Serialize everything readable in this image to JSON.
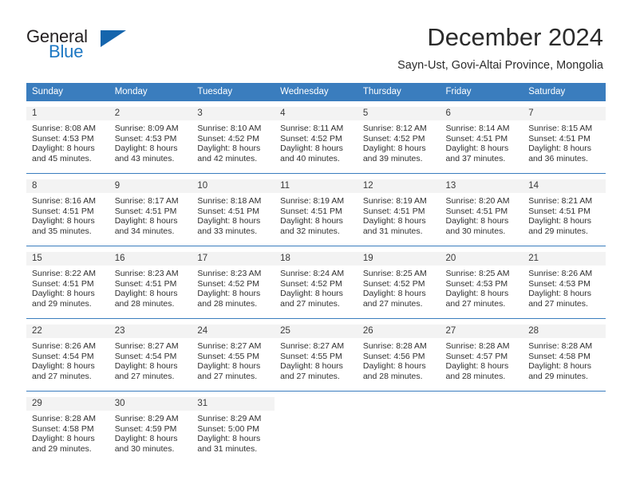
{
  "brand": {
    "name_part1": "General",
    "name_part2": "Blue",
    "triangle_icon": "triangle-logo-icon",
    "color_dark": "#231f20",
    "color_blue": "#1c77c3"
  },
  "header": {
    "month_title": "December 2024",
    "location": "Sayn-Ust, Govi-Altai Province, Mongolia"
  },
  "theme": {
    "header_blue": "#3a7dbe",
    "daynum_gray": "#f3f3f3",
    "text": "#303030"
  },
  "calendar": {
    "weekday_headers": [
      "Sunday",
      "Monday",
      "Tuesday",
      "Wednesday",
      "Thursday",
      "Friday",
      "Saturday"
    ],
    "weeks": [
      [
        {
          "day": "1",
          "sunrise": "Sunrise: 8:08 AM",
          "sunset": "Sunset: 4:53 PM",
          "daylight_line1": "Daylight: 8 hours",
          "daylight_line2": "and 45 minutes."
        },
        {
          "day": "2",
          "sunrise": "Sunrise: 8:09 AM",
          "sunset": "Sunset: 4:53 PM",
          "daylight_line1": "Daylight: 8 hours",
          "daylight_line2": "and 43 minutes."
        },
        {
          "day": "3",
          "sunrise": "Sunrise: 8:10 AM",
          "sunset": "Sunset: 4:52 PM",
          "daylight_line1": "Daylight: 8 hours",
          "daylight_line2": "and 42 minutes."
        },
        {
          "day": "4",
          "sunrise": "Sunrise: 8:11 AM",
          "sunset": "Sunset: 4:52 PM",
          "daylight_line1": "Daylight: 8 hours",
          "daylight_line2": "and 40 minutes."
        },
        {
          "day": "5",
          "sunrise": "Sunrise: 8:12 AM",
          "sunset": "Sunset: 4:52 PM",
          "daylight_line1": "Daylight: 8 hours",
          "daylight_line2": "and 39 minutes."
        },
        {
          "day": "6",
          "sunrise": "Sunrise: 8:14 AM",
          "sunset": "Sunset: 4:51 PM",
          "daylight_line1": "Daylight: 8 hours",
          "daylight_line2": "and 37 minutes."
        },
        {
          "day": "7",
          "sunrise": "Sunrise: 8:15 AM",
          "sunset": "Sunset: 4:51 PM",
          "daylight_line1": "Daylight: 8 hours",
          "daylight_line2": "and 36 minutes."
        }
      ],
      [
        {
          "day": "8",
          "sunrise": "Sunrise: 8:16 AM",
          "sunset": "Sunset: 4:51 PM",
          "daylight_line1": "Daylight: 8 hours",
          "daylight_line2": "and 35 minutes."
        },
        {
          "day": "9",
          "sunrise": "Sunrise: 8:17 AM",
          "sunset": "Sunset: 4:51 PM",
          "daylight_line1": "Daylight: 8 hours",
          "daylight_line2": "and 34 minutes."
        },
        {
          "day": "10",
          "sunrise": "Sunrise: 8:18 AM",
          "sunset": "Sunset: 4:51 PM",
          "daylight_line1": "Daylight: 8 hours",
          "daylight_line2": "and 33 minutes."
        },
        {
          "day": "11",
          "sunrise": "Sunrise: 8:19 AM",
          "sunset": "Sunset: 4:51 PM",
          "daylight_line1": "Daylight: 8 hours",
          "daylight_line2": "and 32 minutes."
        },
        {
          "day": "12",
          "sunrise": "Sunrise: 8:19 AM",
          "sunset": "Sunset: 4:51 PM",
          "daylight_line1": "Daylight: 8 hours",
          "daylight_line2": "and 31 minutes."
        },
        {
          "day": "13",
          "sunrise": "Sunrise: 8:20 AM",
          "sunset": "Sunset: 4:51 PM",
          "daylight_line1": "Daylight: 8 hours",
          "daylight_line2": "and 30 minutes."
        },
        {
          "day": "14",
          "sunrise": "Sunrise: 8:21 AM",
          "sunset": "Sunset: 4:51 PM",
          "daylight_line1": "Daylight: 8 hours",
          "daylight_line2": "and 29 minutes."
        }
      ],
      [
        {
          "day": "15",
          "sunrise": "Sunrise: 8:22 AM",
          "sunset": "Sunset: 4:51 PM",
          "daylight_line1": "Daylight: 8 hours",
          "daylight_line2": "and 29 minutes."
        },
        {
          "day": "16",
          "sunrise": "Sunrise: 8:23 AM",
          "sunset": "Sunset: 4:51 PM",
          "daylight_line1": "Daylight: 8 hours",
          "daylight_line2": "and 28 minutes."
        },
        {
          "day": "17",
          "sunrise": "Sunrise: 8:23 AM",
          "sunset": "Sunset: 4:52 PM",
          "daylight_line1": "Daylight: 8 hours",
          "daylight_line2": "and 28 minutes."
        },
        {
          "day": "18",
          "sunrise": "Sunrise: 8:24 AM",
          "sunset": "Sunset: 4:52 PM",
          "daylight_line1": "Daylight: 8 hours",
          "daylight_line2": "and 27 minutes."
        },
        {
          "day": "19",
          "sunrise": "Sunrise: 8:25 AM",
          "sunset": "Sunset: 4:52 PM",
          "daylight_line1": "Daylight: 8 hours",
          "daylight_line2": "and 27 minutes."
        },
        {
          "day": "20",
          "sunrise": "Sunrise: 8:25 AM",
          "sunset": "Sunset: 4:53 PM",
          "daylight_line1": "Daylight: 8 hours",
          "daylight_line2": "and 27 minutes."
        },
        {
          "day": "21",
          "sunrise": "Sunrise: 8:26 AM",
          "sunset": "Sunset: 4:53 PM",
          "daylight_line1": "Daylight: 8 hours",
          "daylight_line2": "and 27 minutes."
        }
      ],
      [
        {
          "day": "22",
          "sunrise": "Sunrise: 8:26 AM",
          "sunset": "Sunset: 4:54 PM",
          "daylight_line1": "Daylight: 8 hours",
          "daylight_line2": "and 27 minutes."
        },
        {
          "day": "23",
          "sunrise": "Sunrise: 8:27 AM",
          "sunset": "Sunset: 4:54 PM",
          "daylight_line1": "Daylight: 8 hours",
          "daylight_line2": "and 27 minutes."
        },
        {
          "day": "24",
          "sunrise": "Sunrise: 8:27 AM",
          "sunset": "Sunset: 4:55 PM",
          "daylight_line1": "Daylight: 8 hours",
          "daylight_line2": "and 27 minutes."
        },
        {
          "day": "25",
          "sunrise": "Sunrise: 8:27 AM",
          "sunset": "Sunset: 4:55 PM",
          "daylight_line1": "Daylight: 8 hours",
          "daylight_line2": "and 27 minutes."
        },
        {
          "day": "26",
          "sunrise": "Sunrise: 8:28 AM",
          "sunset": "Sunset: 4:56 PM",
          "daylight_line1": "Daylight: 8 hours",
          "daylight_line2": "and 28 minutes."
        },
        {
          "day": "27",
          "sunrise": "Sunrise: 8:28 AM",
          "sunset": "Sunset: 4:57 PM",
          "daylight_line1": "Daylight: 8 hours",
          "daylight_line2": "and 28 minutes."
        },
        {
          "day": "28",
          "sunrise": "Sunrise: 8:28 AM",
          "sunset": "Sunset: 4:58 PM",
          "daylight_line1": "Daylight: 8 hours",
          "daylight_line2": "and 29 minutes."
        }
      ],
      [
        {
          "day": "29",
          "sunrise": "Sunrise: 8:28 AM",
          "sunset": "Sunset: 4:58 PM",
          "daylight_line1": "Daylight: 8 hours",
          "daylight_line2": "and 29 minutes."
        },
        {
          "day": "30",
          "sunrise": "Sunrise: 8:29 AM",
          "sunset": "Sunset: 4:59 PM",
          "daylight_line1": "Daylight: 8 hours",
          "daylight_line2": "and 30 minutes."
        },
        {
          "day": "31",
          "sunrise": "Sunrise: 8:29 AM",
          "sunset": "Sunset: 5:00 PM",
          "daylight_line1": "Daylight: 8 hours",
          "daylight_line2": "and 31 minutes."
        },
        {
          "day": "",
          "sunrise": "",
          "sunset": "",
          "daylight_line1": "",
          "daylight_line2": ""
        },
        {
          "day": "",
          "sunrise": "",
          "sunset": "",
          "daylight_line1": "",
          "daylight_line2": ""
        },
        {
          "day": "",
          "sunrise": "",
          "sunset": "",
          "daylight_line1": "",
          "daylight_line2": ""
        },
        {
          "day": "",
          "sunrise": "",
          "sunset": "",
          "daylight_line1": "",
          "daylight_line2": ""
        }
      ]
    ]
  }
}
